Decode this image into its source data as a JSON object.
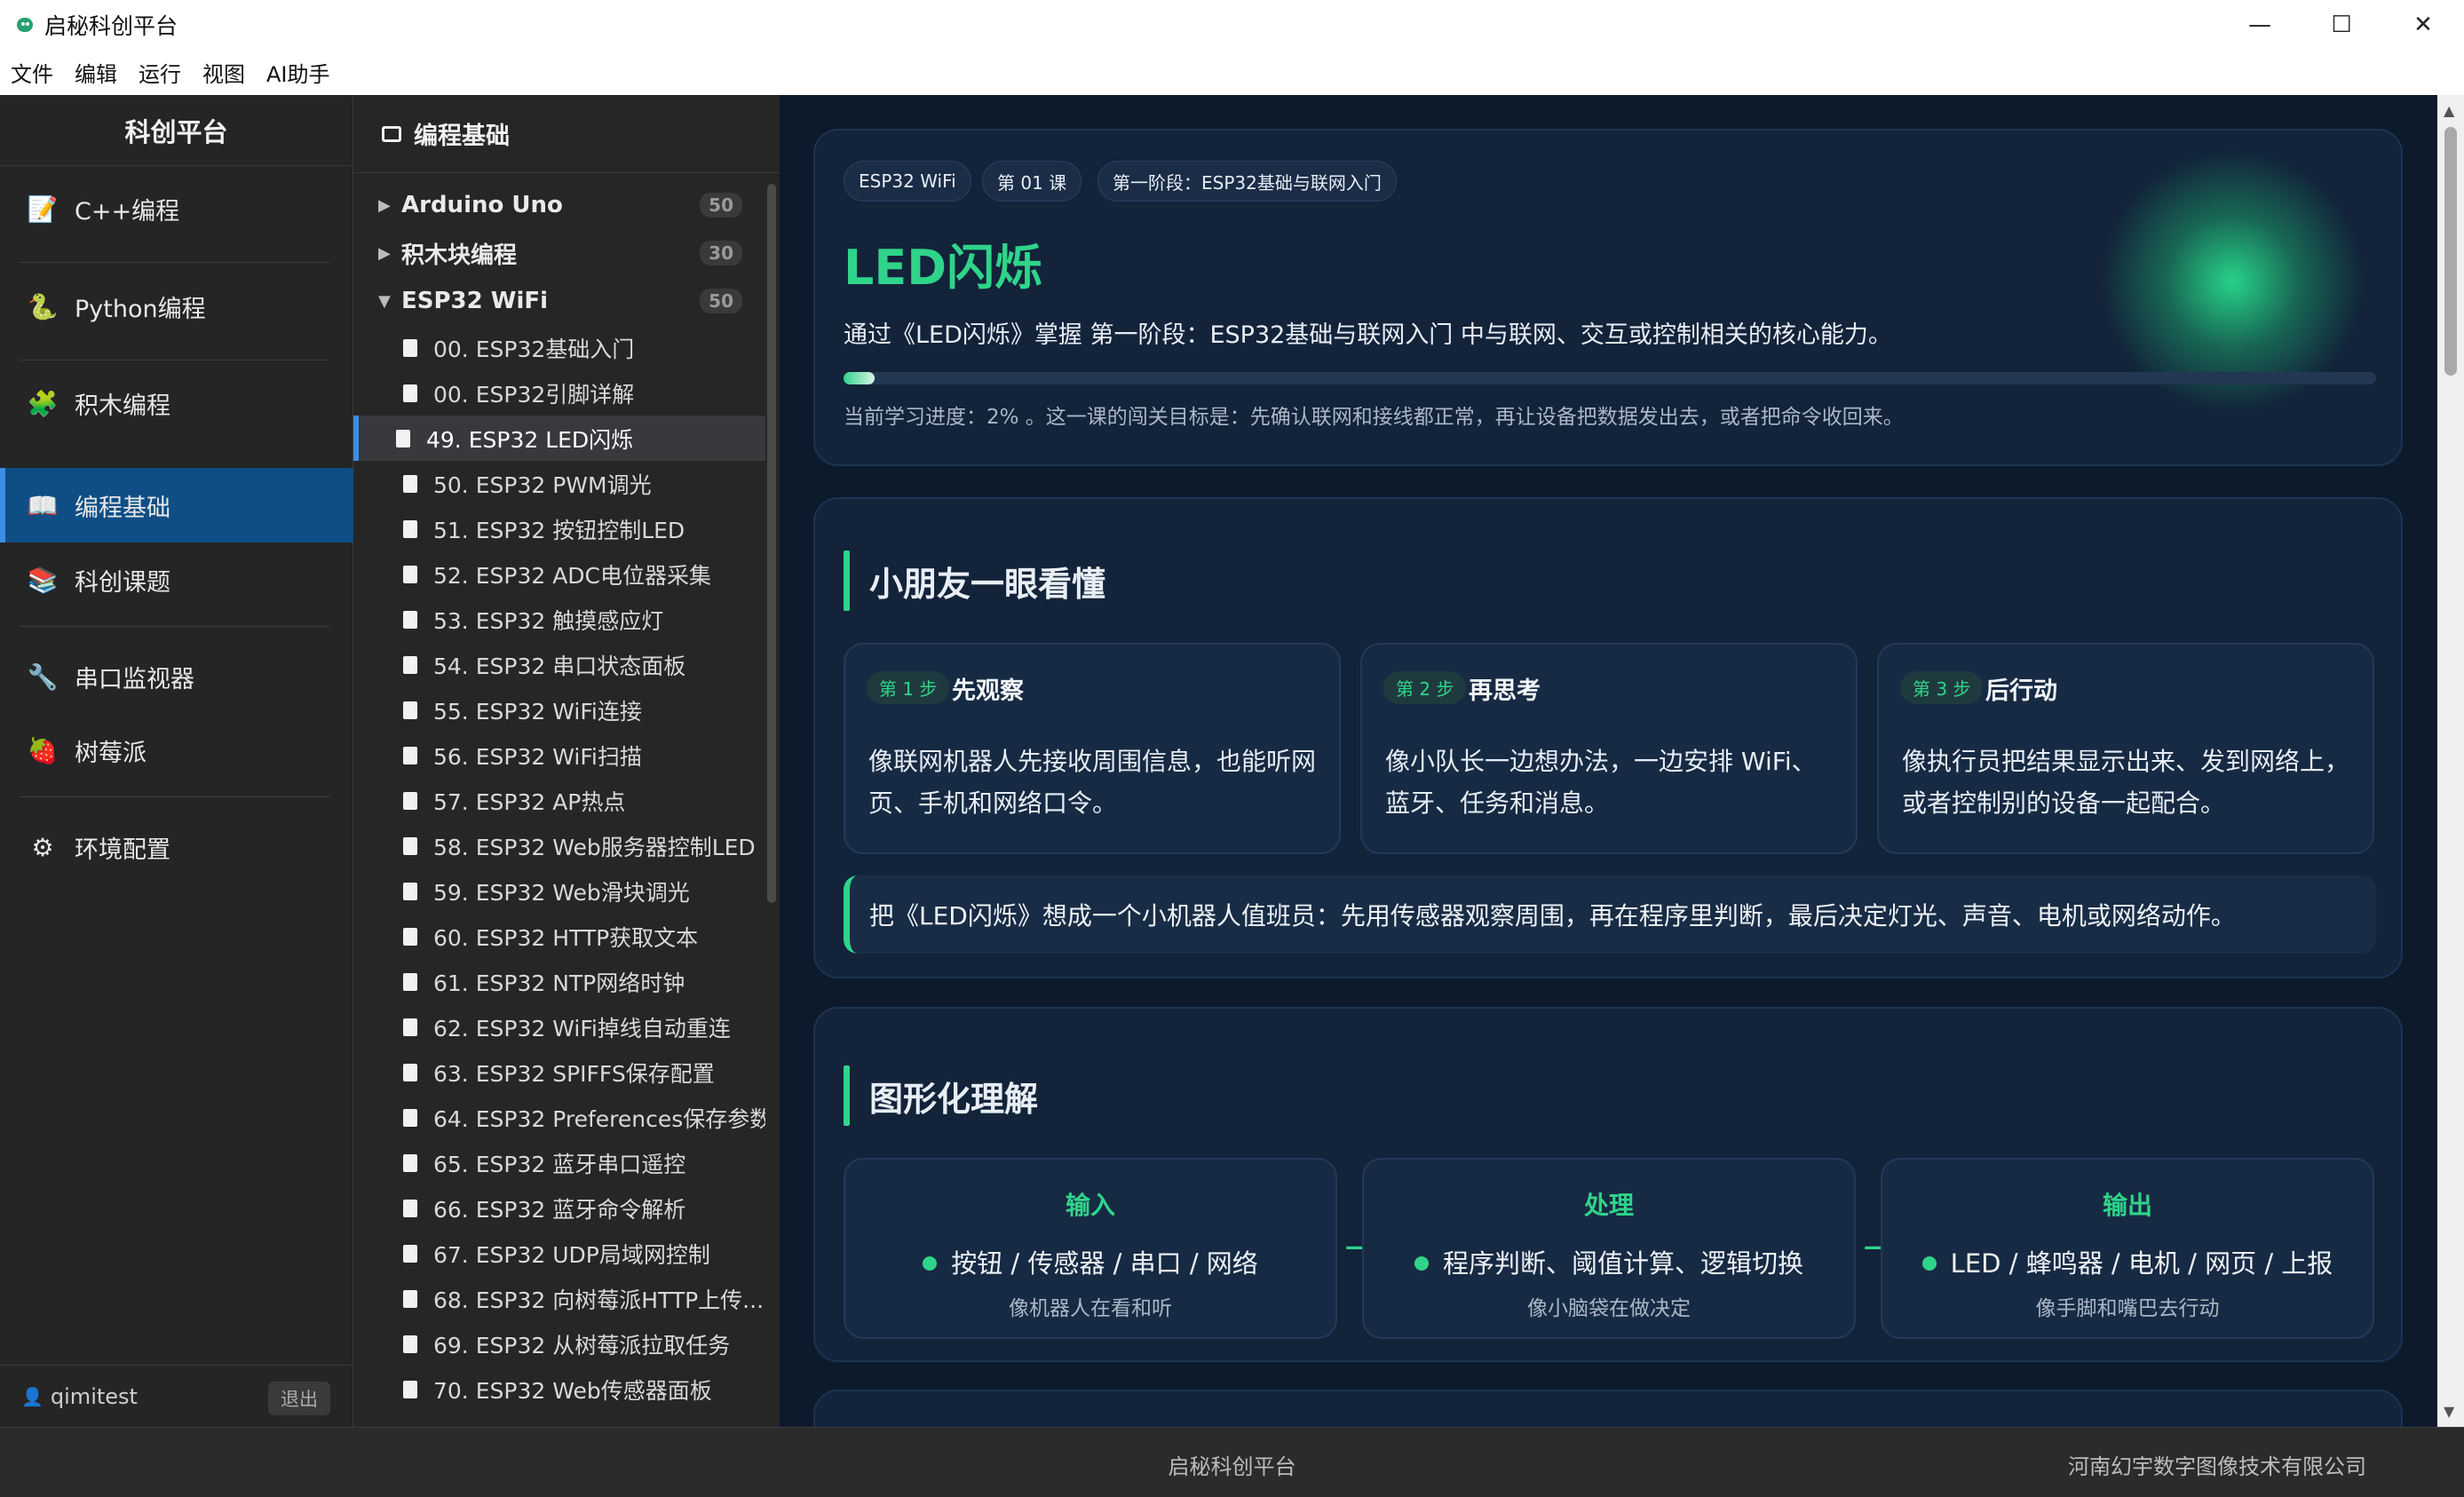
{
  "window": {
    "title": "启秘科创平台",
    "controls": [
      "—",
      "☐",
      "✕"
    ]
  },
  "menu": [
    "文件",
    "编辑",
    "运行",
    "视图",
    "AI助手"
  ],
  "leftnav": {
    "brand": "科创平台",
    "items": [
      {
        "label": "C++编程",
        "icon": "📝"
      },
      {
        "label": "Python编程",
        "icon": "🐍"
      },
      {
        "label": "积木编程",
        "icon": "🧩"
      },
      {
        "label": "编程基础",
        "icon": "📖"
      },
      {
        "label": "科创课题",
        "icon": "📚"
      },
      {
        "label": "串口监视器",
        "icon": "🔧"
      },
      {
        "label": "树莓派",
        "icon": "🍓"
      },
      {
        "label": "环境配置",
        "icon": "⚙"
      }
    ],
    "user": "qimitest",
    "logout": "退出"
  },
  "tree": {
    "header": "编程基础",
    "categories": [
      {
        "label": "Arduino Uno",
        "count": "50",
        "caret": "▶"
      },
      {
        "label": "积木块编程",
        "count": "30",
        "caret": "▶"
      },
      {
        "label": "ESP32 WiFi",
        "count": "50",
        "caret": "▼"
      }
    ],
    "lessons": [
      "00. ESP32基础入门",
      "00. ESP32引脚详解",
      "49. ESP32 LED闪烁",
      "50. ESP32 PWM调光",
      "51. ESP32 按钮控制LED",
      "52. ESP32 ADC电位器采集",
      "53. ESP32 触摸感应灯",
      "54. ESP32 串口状态面板",
      "55. ESP32 WiFi连接",
      "56. ESP32 WiFi扫描",
      "57. ESP32 AP热点",
      "58. ESP32 Web服务器控制LED",
      "59. ESP32 Web滑块调光",
      "60. ESP32 HTTP获取文本",
      "61. ESP32 NTP网络时钟",
      "62. ESP32 WiFi掉线自动重连",
      "63. ESP32 SPIFFS保存配置",
      "64. ESP32 Preferences保存参数",
      "65. ESP32 蓝牙串口遥控",
      "66. ESP32 蓝牙命令解析",
      "67. ESP32 UDP局域网控制",
      "68. ESP32 向树莓派HTTP上传...",
      "69. ESP32 从树莓派拉取任务",
      "70. ESP32 Web传感器面板"
    ]
  },
  "hero": {
    "chips": [
      "ESP32 WiFi",
      "第 01 课",
      "第一阶段：ESP32基础与联网入门"
    ],
    "title": "LED闪烁",
    "desc": "通过《LED闪烁》掌握 第一阶段：ESP32基础与联网入门 中与联网、交互或控制相关的核心能力。",
    "progress": 0.02,
    "note": "当前学习进度：2% 。这一课的闯关目标是：先确认联网和接线都正常，再让设备把数据发出去，或者把命令收回来。"
  },
  "section1": {
    "title": "小朋友一眼看懂",
    "steps": [
      {
        "badge": "第 1 步",
        "title": "先观察",
        "text": "像联网机器人先接收周围信息，也能听网页、手机和网络口令。"
      },
      {
        "badge": "第 2 步",
        "title": "再思考",
        "text": "像小队长一边想办法，一边安排 WiFi、蓝牙、任务和消息。"
      },
      {
        "badge": "第 3 步",
        "title": "后行动",
        "text": "像执行员把结果显示出来、发到网络上，或者控制别的设备一起配合。"
      }
    ],
    "callout": "把《LED闪烁》想成一个小机器人值班员：先用传感器观察周围，再在程序里判断，最后决定灯光、声音、电机或网络动作。"
  },
  "section2": {
    "title": "图形化理解",
    "flow": [
      {
        "title": "输入",
        "main": "按钮 / 传感器 / 串口 / 网络",
        "sub": "像机器人在看和听"
      },
      {
        "title": "处理",
        "main": "程序判断、阈值计算、逻辑切换",
        "sub": "像小脑袋在做决定"
      },
      {
        "title": "输出",
        "main": "LED / 蜂鸣器 / 电机 / 网页 / 上报",
        "sub": "像手脚和嘴巴去行动"
      }
    ],
    "arrow": "→"
  },
  "footer": {
    "center": "启秘科创平台",
    "right": "河南幻宇数字图像技术有限公司"
  },
  "colors": {
    "accent": "#2fd48a",
    "active_nav": "#0f4e85",
    "content_bg": "#0c1a2c"
  }
}
